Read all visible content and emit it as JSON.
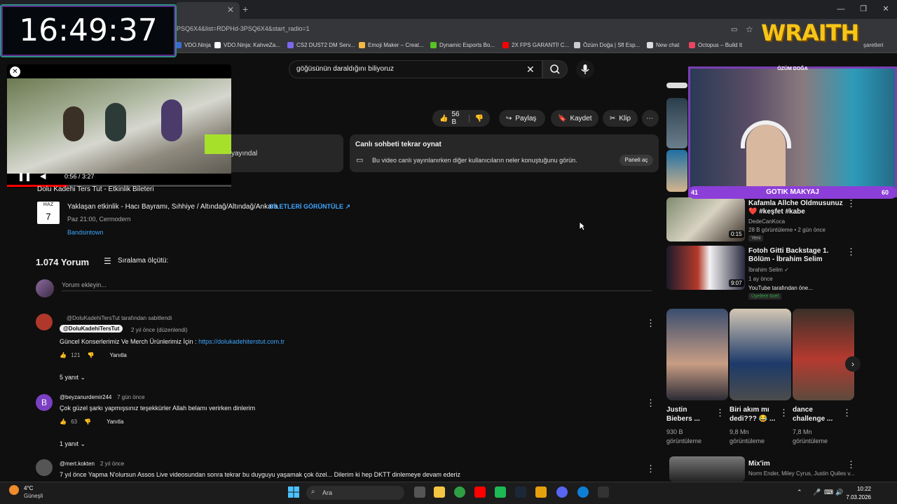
{
  "browser": {
    "url": "PSQ6X4&list=RDPHd-3PSQ6X4&start_radio=1",
    "bookmarks": [
      {
        "label": "VDO.Ninja",
        "color": "#3b6bd6"
      },
      {
        "label": "VDO.Ninja: KahveZa...",
        "color": "#ffffff"
      },
      {
        "label": "CS2 DUST2 DM Serv...",
        "color": "#7b68ee"
      },
      {
        "label": "Emoji Maker – Creat...",
        "color": "#f4b942"
      },
      {
        "label": "Dynamic Esports Bo...",
        "color": "#58c322"
      },
      {
        "label": "2X FPS GARANTİ! C...",
        "color": "#ff0000"
      },
      {
        "label": "Özüm Doğa | Sfl Esp...",
        "color": "#cccccc"
      },
      {
        "label": "New chat",
        "color": "#dddddd"
      },
      {
        "label": "Octopus – Build It",
        "color": "#e94560"
      }
    ],
    "other_bookmarks": "şaretleri"
  },
  "overlay": {
    "clock": "16:49:37",
    "brand": "WRAITH",
    "webcam_name": "ÖZÜM DOĞA",
    "stream_left": "41",
    "stream_title": "GOTIK MAKYAJ",
    "stream_right": "60"
  },
  "search": {
    "query": "göğüsünün daraldığını biliyoruz"
  },
  "miniplayer": {
    "time": "0:56 / 3:27",
    "progress": 0.27
  },
  "actions": {
    "likes": "56 B",
    "share": "Paylaş",
    "save": "Kaydet",
    "clip": "Klip"
  },
  "live_info": {
    "partial_text": "yayındal"
  },
  "live_chat": {
    "title": "Canlı sohbeti tekrar oynat",
    "description": "Bu video canlı yayınlanırken diğer kullanıcıların neler konuştuğunu görün.",
    "panel_button": "Paneli aç"
  },
  "event": {
    "header_cut": "Dolu Kadehi Ters Tut - Etkinlik Bileteri",
    "month": "HAZ",
    "day": "7",
    "title": "Yaklaşan etkinlik - Hacı Bayramı, Sıhhiye / Altındağ/Altındağ/Ankara",
    "tickets": "BİLETLERİ GÖRÜNTÜLE ↗",
    "time": "Paz 21:00, Cermodern",
    "source": "Bandsintown"
  },
  "comments": {
    "count": "1.074 Yorum",
    "sort_label": "Sıralama ölçütü:",
    "add_placeholder": "Yorum ekleyin...",
    "items": [
      {
        "pinned": "@DoluKadehiTersTut tarafından sabitlendi",
        "author": "@DoluKadehiTersTut",
        "time": "2 yıl önce (düzenlendi)",
        "text": "Güncel Konserlerimiz Ve Merch Ürünlerimiz İçin : ",
        "link": "https://dolukadehiterstut.com.tr",
        "likes": "121",
        "reply": "Yanıtla",
        "replies": "5 yanıt",
        "avatar_color": "#b0382b"
      },
      {
        "author": "@beyzanurdemir244",
        "time": "7 gün önce",
        "text": "Çok güzel şarkı yapmışsınız teşekkürler Allah belamı verirken dinlerim",
        "likes": "63",
        "reply": "Yanıtla",
        "replies": "1 yanıt",
        "avatar_letter": "B",
        "avatar_color": "#7b3fc4"
      },
      {
        "author": "@mert.kokten",
        "time": "2 yıl önce",
        "text": "7 yıl önce Yapma N'olursun Assos Live videosundan sonra tekrar bu duyguyu yaşamak çok özel... Dilerim ki hep DKTT dinlemeye devam ederiz",
        "avatar_color": "#555555"
      }
    ]
  },
  "sidebar": {
    "videos": [
      {
        "title": "Kafamla Allche Oldmusunuz ❤️ #keşfet #kabe #challenge...",
        "channel": "DedeCanKoca",
        "meta": "28 B görüntüleme • 2 gün önce",
        "badge": "Yeni",
        "duration": "0:15"
      },
      {
        "title": "Fotoh Gitti Backstage 1. Bölüm - İbrahim Selim",
        "channel": "İbrahim Selim ✓",
        "meta": "1 ay önce",
        "extra": "YouTube tarafından öne...",
        "badge": "Üyelere özel",
        "duration": "9:07"
      }
    ],
    "shorts": [
      {
        "title1": "Justin",
        "title2": "Biebers ...",
        "views1": "930 B",
        "views2": "görüntüleme"
      },
      {
        "title1": "Biri akım mı",
        "title2": "dedi??? 😂 ...",
        "views1": "9,8 Mn",
        "views2": "görüntüleme"
      },
      {
        "title1": "dance",
        "title2": "challenge ...",
        "views1": "7,8 Mn",
        "views2": "görüntüleme"
      }
    ],
    "mix": {
      "title": "Mix'im",
      "subtitle": "Norm Ender, Miley Cyrus, Justin Quiles v..."
    }
  },
  "taskbar": {
    "temp": "4°C",
    "weather": "Güneşli",
    "search_placeholder": "Ara",
    "time": "10:22",
    "date": "7.03.2026"
  }
}
